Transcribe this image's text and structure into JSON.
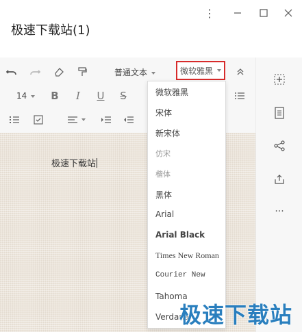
{
  "window": {
    "title": "极速下载站(1)",
    "controls": {
      "more": "⋮",
      "minimize": "—",
      "maximize": "☐",
      "close": "✕"
    }
  },
  "toolbar": {
    "text_style": "普通文本",
    "font_family": "微软雅黑",
    "font_size": "14",
    "bold": "B",
    "italic": "I",
    "underline": "U",
    "strike": "S",
    "collapse": "⌃"
  },
  "font_menu": {
    "options": [
      "微软雅黑",
      "宋体",
      "新宋体",
      "仿宋",
      "楷体",
      "黑体",
      "Arial",
      "Arial Black",
      "Times New Roman",
      "Courier New",
      "Tahoma",
      "Verdana"
    ]
  },
  "document": {
    "text": "极速下载站"
  },
  "watermark": {
    "text": "极速下载站"
  },
  "colors": {
    "accent_border": "#d72b2b",
    "watermark": "#2a7fbe"
  }
}
